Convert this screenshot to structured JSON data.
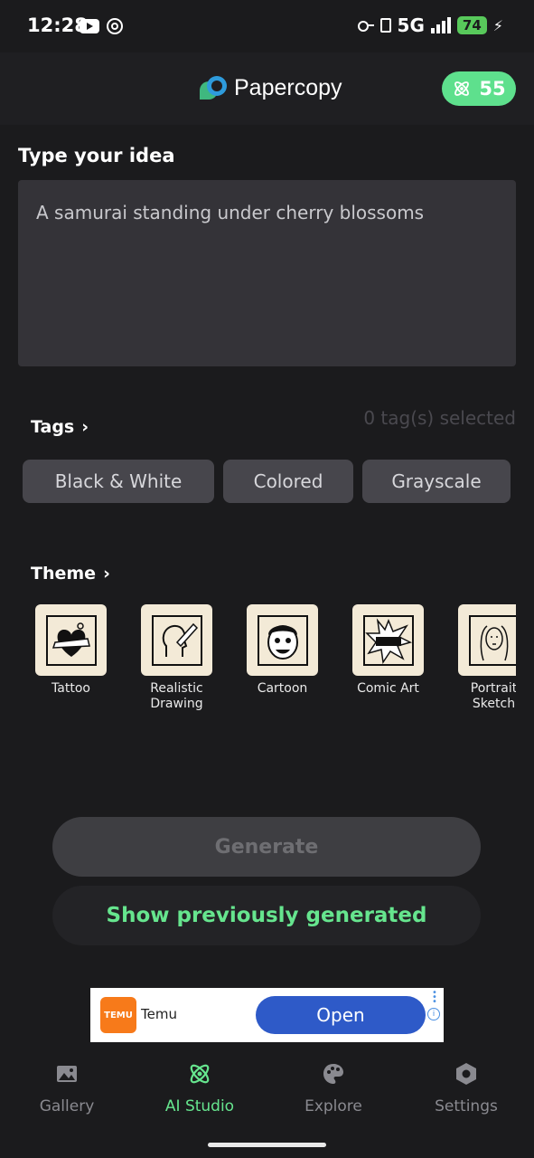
{
  "status_bar": {
    "time": "12:28",
    "network": "5G",
    "battery": "74",
    "icons": [
      "youtube-icon",
      "hotspot-icon",
      "key-icon",
      "vibrate-icon",
      "signal-icon",
      "battery-icon",
      "charging-icon"
    ]
  },
  "header": {
    "app_name": "Papercopy",
    "credits": "55",
    "accent_color": "#5ee08d"
  },
  "idea": {
    "title": "Type your idea",
    "value": "A samurai standing under cherry blossoms"
  },
  "tags": {
    "title": "Tags",
    "selected_count": "0 tag(s) selected",
    "items": [
      {
        "label": "Black & White"
      },
      {
        "label": "Colored"
      },
      {
        "label": "Grayscale"
      }
    ]
  },
  "theme": {
    "title": "Theme",
    "items": [
      {
        "label": "Tattoo",
        "icon": "tattoo-heart-icon"
      },
      {
        "label": "Realistic\nDrawing",
        "icon": "realistic-drawing-icon"
      },
      {
        "label": "Cartoon",
        "icon": "cartoon-face-icon"
      },
      {
        "label": "Comic Art",
        "icon": "comic-burst-icon"
      },
      {
        "label": "Portrait\nSketch",
        "icon": "portrait-sketch-icon"
      }
    ]
  },
  "actions": {
    "generate": "Generate",
    "show_previous": "Show previously generated"
  },
  "ad": {
    "advertiser": "Temu",
    "logo_text": "TEMU",
    "cta": "Open"
  },
  "nav": {
    "items": [
      {
        "label": "Gallery",
        "icon": "image-icon"
      },
      {
        "label": "AI Studio",
        "icon": "atom-icon"
      },
      {
        "label": "Explore",
        "icon": "palette-icon"
      },
      {
        "label": "Settings",
        "icon": "hexagon-settings-icon"
      }
    ],
    "active": "AI Studio"
  }
}
